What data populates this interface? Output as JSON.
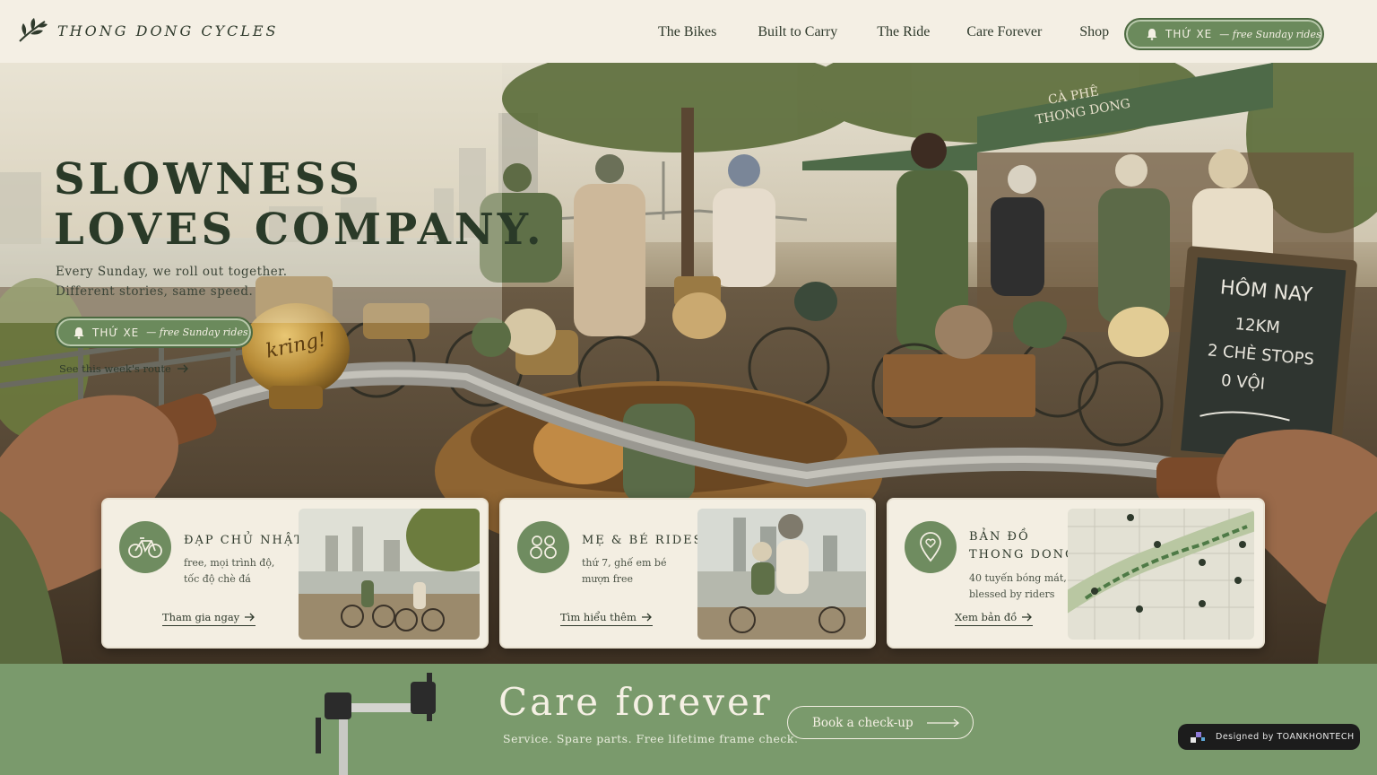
{
  "brand": {
    "name": "THONG DONG CYCLES",
    "logo_icon": "leaf-sprig-icon"
  },
  "nav": {
    "items": [
      "The Bikes",
      "Built to Carry",
      "The Ride",
      "Care Forever",
      "Shop"
    ],
    "cta": {
      "strong": "THỨ XE",
      "em": "— free Sunday rides",
      "icon": "bell-icon"
    }
  },
  "hero": {
    "title_line1": "SLOWNESS",
    "title_line2": "LOVES COMPANY.",
    "sub_line1": "Every Sunday, we roll out together.",
    "sub_line2": "Different stories, same speed.",
    "cta": {
      "strong": "THỨ XE",
      "em": "— free Sunday rides",
      "icon": "bell-icon"
    },
    "link": "See this week's route",
    "bell_text": "kring!",
    "cafe_sign_line1": "CÀ PHÊ",
    "cafe_sign_line2": "THONG DONG",
    "chalkboard": [
      "HÔM NAY",
      "12KM",
      "2 CHÈ STOPS",
      "0 VỘI"
    ]
  },
  "cards": [
    {
      "title": "ĐẠP CHỦ NHẬT",
      "desc_line1": "free, mọi trình độ,",
      "desc_line2": "tốc độ chè đá",
      "link": "Tham gia ngay",
      "icon": "bicycle-icon"
    },
    {
      "title": "MẸ & BÉ RIDES",
      "desc_line1": "thứ 7, ghế em bé",
      "desc_line2": "mượn free",
      "link": "Tìm hiểu thêm",
      "icon": "family-bikes-icon"
    },
    {
      "title_line1": "BẢN ĐỒ",
      "title_line2": "THONG DONG",
      "desc_line1": "40 tuyến bóng mát,",
      "desc_line2": "blessed by riders",
      "link": "Xem bản đồ",
      "icon": "map-pin-heart-icon"
    }
  ],
  "care": {
    "title": "Care forever",
    "subtitle": "Service. Spare parts. Free lifetime frame check.",
    "button": "Book a check-up"
  },
  "badge": {
    "text": "Designed by TOANKHONTECH"
  },
  "colors": {
    "accent": "#6b8a5c",
    "band": "#7a9a6c",
    "cream": "#f4efe4",
    "ink": "#2f3a2c"
  }
}
